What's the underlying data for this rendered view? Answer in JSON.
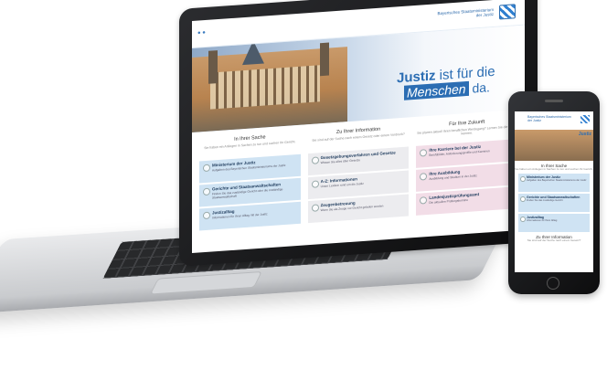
{
  "header": {
    "ministry_line1": "Bayerisches Staatsministerium",
    "ministry_line2": "der Justiz",
    "nav_icon": "menu-dots-icon",
    "coat_of_arms_icon": "bavarian-coat-of-arms-icon"
  },
  "hero": {
    "slogan_bold": "Justiz",
    "slogan_rest": " ist für die",
    "slogan_boxed": "Menschen",
    "slogan_end": " da."
  },
  "columns": [
    {
      "title": "In Ihrer Sache",
      "subtitle": "Sie haben ein Anliegen in Sachen zu tun und suchen Ihr Gericht.",
      "tiles": [
        {
          "title": "Ministerium der Justiz",
          "text": "Aufgaben des Bayerischen Staatsministeriums der Justiz"
        },
        {
          "title": "Gerichte und Staatsanwaltschaften",
          "text": "Finden Sie das zuständige Gericht oder die zuständige Staatsanwaltschaft"
        },
        {
          "title": "Justizalltag",
          "text": "Informationen für Ihren Alltag mit der Justiz"
        }
      ]
    },
    {
      "title": "Zu Ihrer Information",
      "subtitle": "Sie sind auf der Suche nach einem Gesetz oder einem Vordruck?",
      "tiles": [
        {
          "title": "Gesetzgebungsverfahren und Gesetze",
          "text": "Wissen Sie alles über Gesetze"
        },
        {
          "title": "A-Z: Informationen",
          "text": "Unser Lexikon rund um die Justiz"
        },
        {
          "title": "Zeugenbetreuung",
          "text": "Wenn Sie als Zeuge vor Gericht geladen werden"
        }
      ]
    },
    {
      "title": "Für Ihre Zukunft",
      "subtitle": "Sie planen aktuell Ihren beruflichen Werdegang? Lernen Sie die Justiz kennen.",
      "tiles": [
        {
          "title": "Ihre Karriere bei der Justiz",
          "text": "Berufsbilder, Anforderungsprofile und Karrieren"
        },
        {
          "title": "Ihre Ausbildung",
          "text": "Ausbildung und Studium in der Justiz"
        },
        {
          "title": "Landesjustizprüfungsamt",
          "text": "Die aktuellen Prüfungstermine"
        }
      ]
    }
  ],
  "phone": {
    "slogan": "Justiz",
    "section1_title": "In Ihrer Sache",
    "section1_sub": "Sie haben ein Anliegen in Sachen zu tun und suchen Ihr Gericht.",
    "tiles": [
      {
        "title": "Ministerium der Justiz",
        "text": "Aufgaben des Bayerischen Staatsministeriums der Justiz"
      },
      {
        "title": "Gerichte und Staatsanwaltschaften",
        "text": "Finden Sie das zuständige Gericht"
      },
      {
        "title": "Justizalltag",
        "text": "Informationen für Ihren Alltag"
      }
    ],
    "section2_title": "Zu Ihrer Information",
    "section2_sub": "Sie sind auf der Suche nach einem Gesetz?"
  }
}
